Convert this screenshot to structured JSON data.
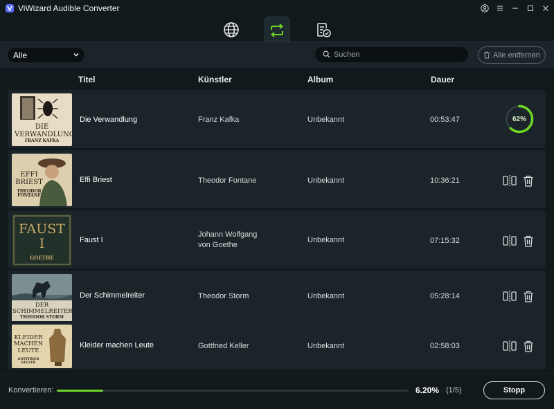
{
  "window": {
    "title": "ViWizard Audible Converter"
  },
  "nav": {
    "tabs": [
      {
        "icon": "globe-icon"
      },
      {
        "icon": "convert-icon",
        "active": true
      },
      {
        "icon": "converted-list-icon"
      }
    ]
  },
  "toolbar": {
    "filter_value": "Alle",
    "search_placeholder": "Suchen",
    "remove_all_label": "Alle entfernen"
  },
  "table": {
    "headers": {
      "title": "Titel",
      "artist": "Künstler",
      "album": "Album",
      "duration": "Dauer"
    },
    "rows": [
      {
        "title": "Die Verwandlung",
        "artist": "Franz Kafka",
        "album": "Unbekannt",
        "duration": "00:53:47",
        "cover_title": "DIE VERWANDLUNG",
        "cover_author": "FRANZ KAFKA",
        "progress_label": "62%",
        "progress": 0.62
      },
      {
        "title": "Effi Briest",
        "artist": "Theodor Fontane",
        "album": "Unbekannt",
        "duration": "10:36:21",
        "cover_title": "EFFI BRIEST",
        "cover_author": "THEODOR FONTANE"
      },
      {
        "title": "Faust I",
        "artist_line1": "Johann Wolfgang",
        "artist_line2": "von Goethe",
        "album": "Unbekannt",
        "duration": "07:15:32",
        "cover_title": "FAUST I",
        "cover_author": "GOETHE"
      },
      {
        "title": "Der Schimmelreiter",
        "artist": "Theodor Storm",
        "album": "Unbekannt",
        "duration": "05:28:14",
        "cover_title": "DER SCHIMMELREITER",
        "cover_author": "THEODOR STORM"
      },
      {
        "title": "Kleider machen Leute",
        "artist": "Gottfried Keller",
        "album": "Unbekannt",
        "duration": "02:58:03",
        "cover_title": "KLEIDER MACHEN LEUTE",
        "cover_author": "GOTTFRIED KELLER"
      }
    ]
  },
  "footer": {
    "label": "Konvertieren:",
    "percent": "6.20%",
    "count": "(1/5)",
    "progress": 0.062,
    "stop_label": "Stopp"
  },
  "colors": {
    "accent": "#6fd627",
    "background": "#12191c",
    "row": "#1b2428"
  }
}
